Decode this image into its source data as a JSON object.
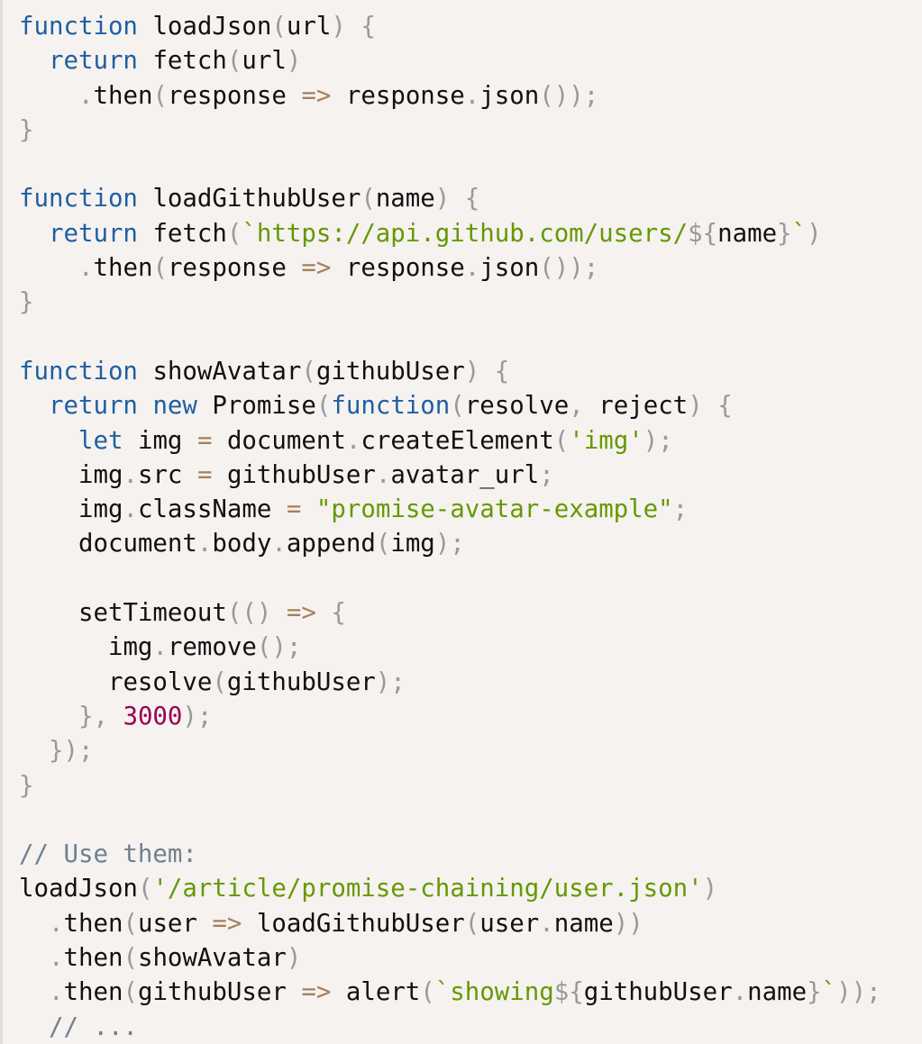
{
  "theme": {
    "background": "#f5f2f0",
    "keyword": "#1f5fa0",
    "identifier": "#111111",
    "punctuation": "#999999",
    "operator": "#a67f59",
    "string": "#669900",
    "number": "#990055",
    "comment": "#708090"
  },
  "code": {
    "language": "javascript",
    "lines": [
      [
        [
          "k",
          "function"
        ],
        [
          "p",
          " "
        ],
        [
          "i",
          "loadJson"
        ],
        [
          "u",
          "("
        ],
        [
          "i",
          "url"
        ],
        [
          "u",
          ")"
        ],
        [
          "p",
          " "
        ],
        [
          "u",
          "{"
        ]
      ],
      [
        [
          "p",
          "  "
        ],
        [
          "k",
          "return"
        ],
        [
          "p",
          " "
        ],
        [
          "i",
          "fetch"
        ],
        [
          "u",
          "("
        ],
        [
          "i",
          "url"
        ],
        [
          "u",
          ")"
        ]
      ],
      [
        [
          "p",
          "    "
        ],
        [
          "u",
          "."
        ],
        [
          "i",
          "then"
        ],
        [
          "u",
          "("
        ],
        [
          "i",
          "response"
        ],
        [
          "p",
          " "
        ],
        [
          "o",
          "=>"
        ],
        [
          "p",
          " "
        ],
        [
          "i",
          "response"
        ],
        [
          "u",
          "."
        ],
        [
          "i",
          "json"
        ],
        [
          "u",
          "());"
        ]
      ],
      [
        [
          "u",
          "}"
        ]
      ],
      [],
      [
        [
          "k",
          "function"
        ],
        [
          "p",
          " "
        ],
        [
          "i",
          "loadGithubUser"
        ],
        [
          "u",
          "("
        ],
        [
          "i",
          "name"
        ],
        [
          "u",
          ")"
        ],
        [
          "p",
          " "
        ],
        [
          "u",
          "{"
        ]
      ],
      [
        [
          "p",
          "  "
        ],
        [
          "k",
          "return"
        ],
        [
          "p",
          " "
        ],
        [
          "i",
          "fetch"
        ],
        [
          "u",
          "("
        ],
        [
          "s",
          "`https://api.github.com/users/"
        ],
        [
          "u",
          "${"
        ],
        [
          "i",
          "name"
        ],
        [
          "u",
          "}"
        ],
        [
          "s",
          "`"
        ],
        [
          "u",
          ")"
        ]
      ],
      [
        [
          "p",
          "    "
        ],
        [
          "u",
          "."
        ],
        [
          "i",
          "then"
        ],
        [
          "u",
          "("
        ],
        [
          "i",
          "response"
        ],
        [
          "p",
          " "
        ],
        [
          "o",
          "=>"
        ],
        [
          "p",
          " "
        ],
        [
          "i",
          "response"
        ],
        [
          "u",
          "."
        ],
        [
          "i",
          "json"
        ],
        [
          "u",
          "());"
        ]
      ],
      [
        [
          "u",
          "}"
        ]
      ],
      [],
      [
        [
          "k",
          "function"
        ],
        [
          "p",
          " "
        ],
        [
          "i",
          "showAvatar"
        ],
        [
          "u",
          "("
        ],
        [
          "i",
          "githubUser"
        ],
        [
          "u",
          ")"
        ],
        [
          "p",
          " "
        ],
        [
          "u",
          "{"
        ]
      ],
      [
        [
          "p",
          "  "
        ],
        [
          "k",
          "return"
        ],
        [
          "p",
          " "
        ],
        [
          "k",
          "new"
        ],
        [
          "p",
          " "
        ],
        [
          "i",
          "Promise"
        ],
        [
          "u",
          "("
        ],
        [
          "k",
          "function"
        ],
        [
          "u",
          "("
        ],
        [
          "i",
          "resolve"
        ],
        [
          "u",
          ","
        ],
        [
          "p",
          " "
        ],
        [
          "i",
          "reject"
        ],
        [
          "u",
          ")"
        ],
        [
          "p",
          " "
        ],
        [
          "u",
          "{"
        ]
      ],
      [
        [
          "p",
          "    "
        ],
        [
          "k",
          "let"
        ],
        [
          "p",
          " "
        ],
        [
          "i",
          "img"
        ],
        [
          "p",
          " "
        ],
        [
          "o",
          "="
        ],
        [
          "p",
          " "
        ],
        [
          "i",
          "document"
        ],
        [
          "u",
          "."
        ],
        [
          "i",
          "createElement"
        ],
        [
          "u",
          "("
        ],
        [
          "s",
          "'img'"
        ],
        [
          "u",
          ");"
        ]
      ],
      [
        [
          "p",
          "    "
        ],
        [
          "i",
          "img"
        ],
        [
          "u",
          "."
        ],
        [
          "i",
          "src"
        ],
        [
          "p",
          " "
        ],
        [
          "o",
          "="
        ],
        [
          "p",
          " "
        ],
        [
          "i",
          "githubUser"
        ],
        [
          "u",
          "."
        ],
        [
          "i",
          "avatar_url"
        ],
        [
          "u",
          ";"
        ]
      ],
      [
        [
          "p",
          "    "
        ],
        [
          "i",
          "img"
        ],
        [
          "u",
          "."
        ],
        [
          "i",
          "className"
        ],
        [
          "p",
          " "
        ],
        [
          "o",
          "="
        ],
        [
          "p",
          " "
        ],
        [
          "s",
          "\"promise-avatar-example\""
        ],
        [
          "u",
          ";"
        ]
      ],
      [
        [
          "p",
          "    "
        ],
        [
          "i",
          "document"
        ],
        [
          "u",
          "."
        ],
        [
          "i",
          "body"
        ],
        [
          "u",
          "."
        ],
        [
          "i",
          "append"
        ],
        [
          "u",
          "("
        ],
        [
          "i",
          "img"
        ],
        [
          "u",
          ");"
        ]
      ],
      [],
      [
        [
          "p",
          "    "
        ],
        [
          "i",
          "setTimeout"
        ],
        [
          "u",
          "(()"
        ],
        [
          "p",
          " "
        ],
        [
          "o",
          "=>"
        ],
        [
          "p",
          " "
        ],
        [
          "u",
          "{"
        ]
      ],
      [
        [
          "p",
          "      "
        ],
        [
          "i",
          "img"
        ],
        [
          "u",
          "."
        ],
        [
          "i",
          "remove"
        ],
        [
          "u",
          "();"
        ]
      ],
      [
        [
          "p",
          "      "
        ],
        [
          "i",
          "resolve"
        ],
        [
          "u",
          "("
        ],
        [
          "i",
          "githubUser"
        ],
        [
          "u",
          ");"
        ]
      ],
      [
        [
          "p",
          "    "
        ],
        [
          "u",
          "},"
        ],
        [
          "p",
          " "
        ],
        [
          "n",
          "3000"
        ],
        [
          "u",
          ");"
        ]
      ],
      [
        [
          "p",
          "  "
        ],
        [
          "u",
          "});"
        ]
      ],
      [
        [
          "u",
          "}"
        ]
      ],
      [],
      [
        [
          "c",
          "// Use them:"
        ]
      ],
      [
        [
          "i",
          "loadJson"
        ],
        [
          "u",
          "("
        ],
        [
          "s",
          "'/article/promise-chaining/user.json'"
        ],
        [
          "u",
          ")"
        ]
      ],
      [
        [
          "p",
          "  "
        ],
        [
          "u",
          "."
        ],
        [
          "i",
          "then"
        ],
        [
          "u",
          "("
        ],
        [
          "i",
          "user"
        ],
        [
          "p",
          " "
        ],
        [
          "o",
          "=>"
        ],
        [
          "p",
          " "
        ],
        [
          "i",
          "loadGithubUser"
        ],
        [
          "u",
          "("
        ],
        [
          "i",
          "user"
        ],
        [
          "u",
          "."
        ],
        [
          "i",
          "name"
        ],
        [
          "u",
          "))"
        ]
      ],
      [
        [
          "p",
          "  "
        ],
        [
          "u",
          "."
        ],
        [
          "i",
          "then"
        ],
        [
          "u",
          "("
        ],
        [
          "i",
          "showAvatar"
        ],
        [
          "u",
          ")"
        ]
      ],
      [
        [
          "p",
          "  "
        ],
        [
          "u",
          "."
        ],
        [
          "i",
          "then"
        ],
        [
          "u",
          "("
        ],
        [
          "i",
          "githubUser"
        ],
        [
          "p",
          " "
        ],
        [
          "o",
          "=>"
        ],
        [
          "p",
          " "
        ],
        [
          "i",
          "alert"
        ],
        [
          "u",
          "("
        ],
        [
          "s",
          "`showing"
        ],
        [
          "u",
          "${"
        ],
        [
          "i",
          "githubUser"
        ],
        [
          "u",
          "."
        ],
        [
          "i",
          "name"
        ],
        [
          "u",
          "}"
        ],
        [
          "s",
          "`"
        ],
        [
          "u",
          "));"
        ]
      ],
      [
        [
          "p",
          "  "
        ],
        [
          "c",
          "// ..."
        ]
      ]
    ]
  }
}
